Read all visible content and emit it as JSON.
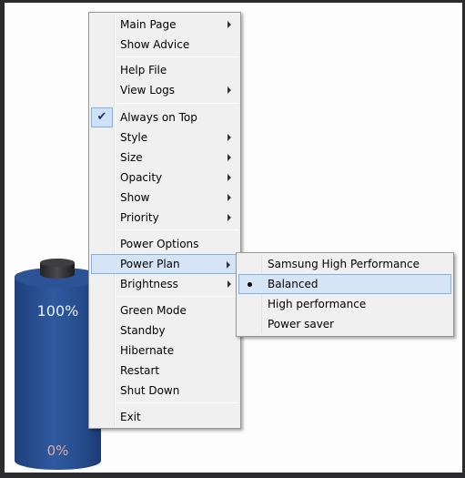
{
  "battery": {
    "top_label": "100%",
    "bottom_label": "0%"
  },
  "menu": {
    "items": [
      {
        "label": "Main Page",
        "submenu": true
      },
      {
        "label": "Show Advice"
      },
      {
        "label": "Help File"
      },
      {
        "label": "View Logs",
        "submenu": true
      },
      {
        "label": "Always on Top",
        "checked": true
      },
      {
        "label": "Style",
        "submenu": true
      },
      {
        "label": "Size",
        "submenu": true
      },
      {
        "label": "Opacity",
        "submenu": true
      },
      {
        "label": "Show",
        "submenu": true
      },
      {
        "label": "Priority",
        "submenu": true
      },
      {
        "label": "Power Options"
      },
      {
        "label": "Power Plan",
        "submenu": true,
        "highlighted": true
      },
      {
        "label": "Brightness",
        "submenu": true
      },
      {
        "label": "Green Mode"
      },
      {
        "label": "Standby"
      },
      {
        "label": "Hibernate"
      },
      {
        "label": "Restart"
      },
      {
        "label": "Shut Down"
      },
      {
        "label": "Exit"
      }
    ]
  },
  "power_plan_menu": {
    "items": [
      {
        "label": "Samsung High Performance"
      },
      {
        "label": "Balanced",
        "selected": true
      },
      {
        "label": "High performance"
      },
      {
        "label": "Power saver"
      }
    ]
  }
}
